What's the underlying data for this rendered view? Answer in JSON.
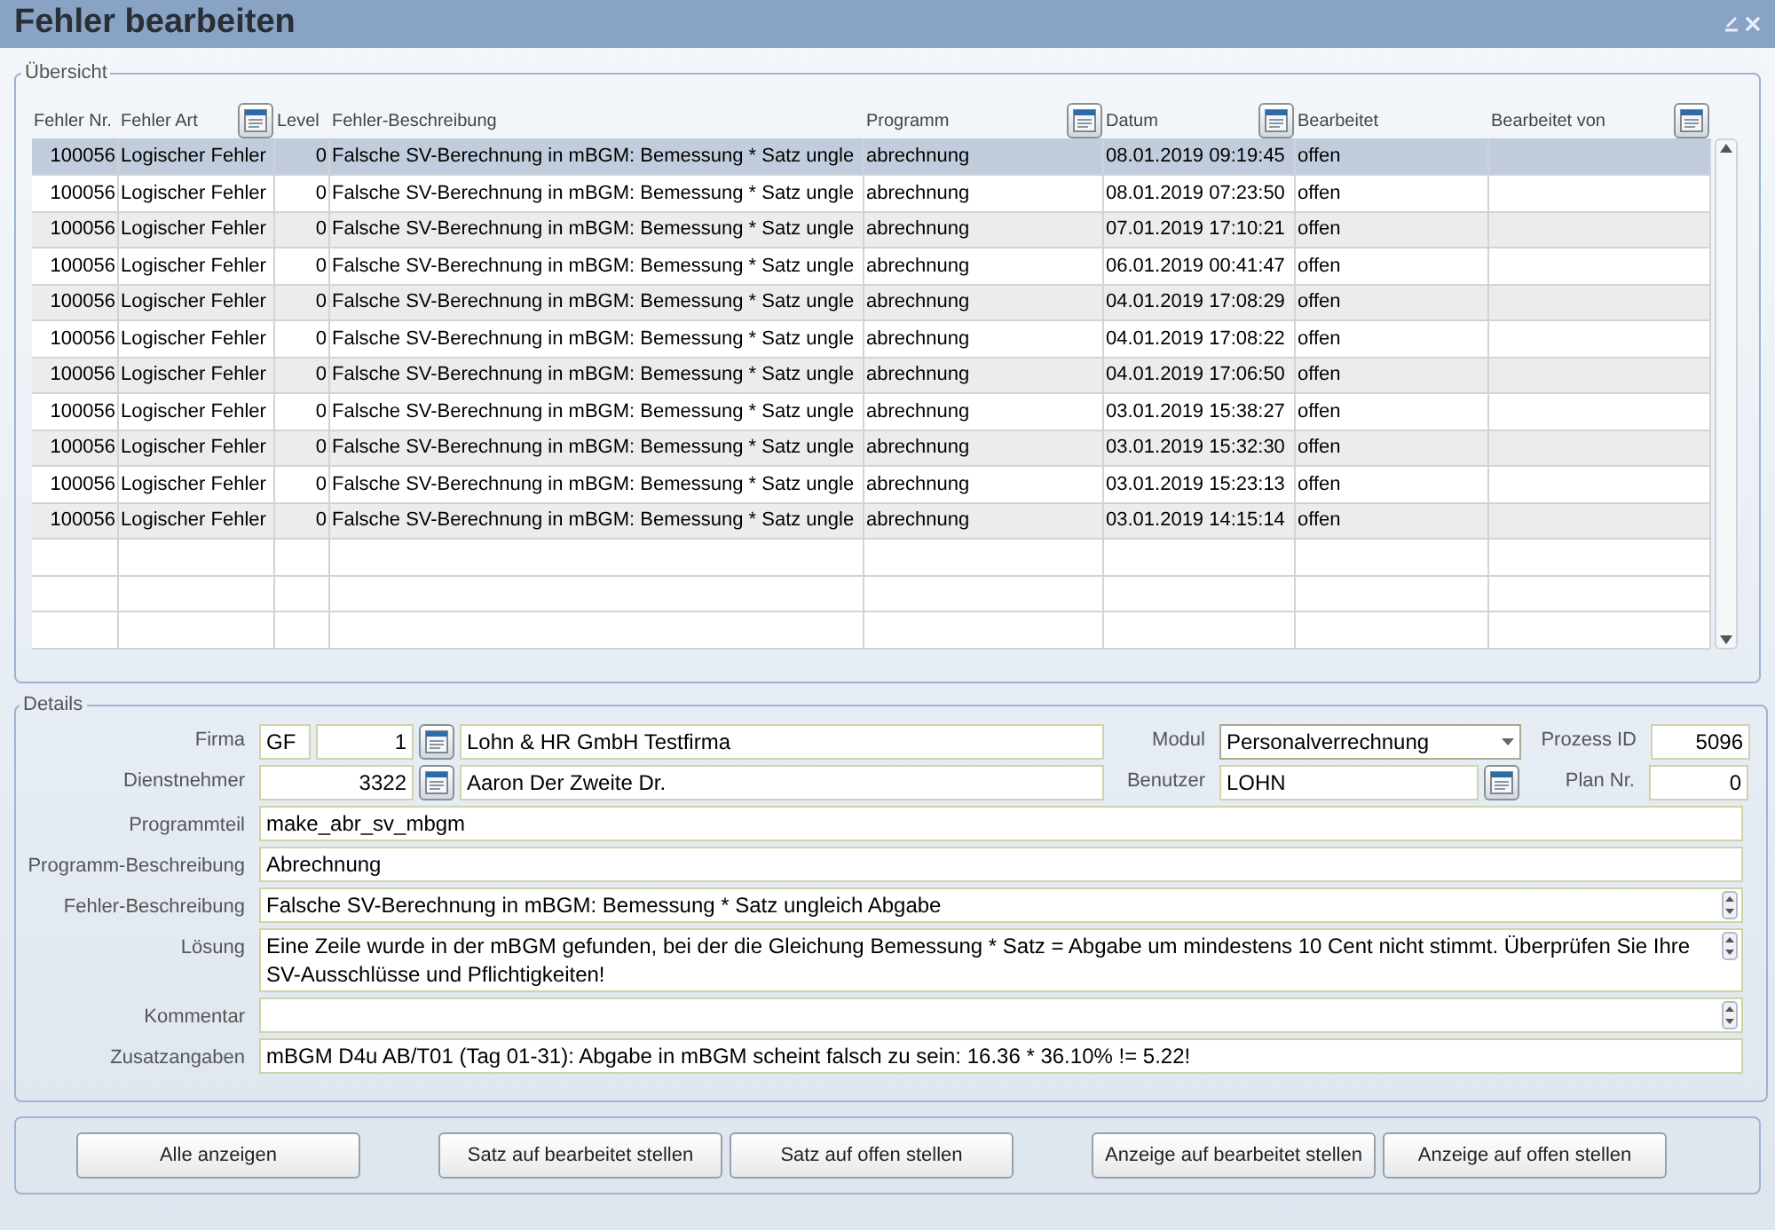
{
  "title": "Fehler bearbeiten",
  "overview": {
    "legend": "Übersicht",
    "columns": [
      {
        "label": "Fehler Nr.",
        "picker": false
      },
      {
        "label": "Fehler Art",
        "picker": true
      },
      {
        "label": "Level",
        "picker": false
      },
      {
        "label": "Fehler-Beschreibung",
        "picker": false
      },
      {
        "label": "Programm",
        "picker": true
      },
      {
        "label": "Datum",
        "picker": true
      },
      {
        "label": "Bearbeitet",
        "picker": false
      },
      {
        "label": "Bearbeitet von",
        "picker": true
      }
    ],
    "rows": [
      {
        "selected": true,
        "cells": [
          "100056",
          "Logischer Fehler",
          "0",
          "Falsche SV-Berechnung in mBGM: Bemessung * Satz ungle",
          "abrechnung",
          "08.01.2019 09:19:45",
          "offen"
        ]
      },
      {
        "selected": false,
        "cells": [
          "100056",
          "Logischer Fehler",
          "0",
          "Falsche SV-Berechnung in mBGM: Bemessung * Satz ungle",
          "abrechnung",
          "08.01.2019 07:23:50",
          "offen"
        ]
      },
      {
        "selected": false,
        "cells": [
          "100056",
          "Logischer Fehler",
          "0",
          "Falsche SV-Berechnung in mBGM: Bemessung * Satz ungle",
          "abrechnung",
          "07.01.2019 17:10:21",
          "offen"
        ]
      },
      {
        "selected": false,
        "cells": [
          "100056",
          "Logischer Fehler",
          "0",
          "Falsche SV-Berechnung in mBGM: Bemessung * Satz ungle",
          "abrechnung",
          "06.01.2019 00:41:47",
          "offen"
        ]
      },
      {
        "selected": false,
        "cells": [
          "100056",
          "Logischer Fehler",
          "0",
          "Falsche SV-Berechnung in mBGM: Bemessung * Satz ungle",
          "abrechnung",
          "04.01.2019 17:08:29",
          "offen"
        ]
      },
      {
        "selected": false,
        "cells": [
          "100056",
          "Logischer Fehler",
          "0",
          "Falsche SV-Berechnung in mBGM: Bemessung * Satz ungle",
          "abrechnung",
          "04.01.2019 17:08:22",
          "offen"
        ]
      },
      {
        "selected": false,
        "cells": [
          "100056",
          "Logischer Fehler",
          "0",
          "Falsche SV-Berechnung in mBGM: Bemessung * Satz ungle",
          "abrechnung",
          "04.01.2019 17:06:50",
          "offen"
        ]
      },
      {
        "selected": false,
        "cells": [
          "100056",
          "Logischer Fehler",
          "0",
          "Falsche SV-Berechnung in mBGM: Bemessung * Satz ungle",
          "abrechnung",
          "03.01.2019 15:38:27",
          "offen"
        ]
      },
      {
        "selected": false,
        "cells": [
          "100056",
          "Logischer Fehler",
          "0",
          "Falsche SV-Berechnung in mBGM: Bemessung * Satz ungle",
          "abrechnung",
          "03.01.2019 15:32:30",
          "offen"
        ]
      },
      {
        "selected": false,
        "cells": [
          "100056",
          "Logischer Fehler",
          "0",
          "Falsche SV-Berechnung in mBGM: Bemessung * Satz ungle",
          "abrechnung",
          "03.01.2019 15:23:13",
          "offen"
        ]
      },
      {
        "selected": false,
        "cells": [
          "100056",
          "Logischer Fehler",
          "0",
          "Falsche SV-Berechnung in mBGM: Bemessung * Satz ungle",
          "abrechnung",
          "03.01.2019 14:15:14",
          "offen"
        ]
      }
    ]
  },
  "details": {
    "legend": "Details",
    "firma": {
      "label": "Firma",
      "code": "GF",
      "number": "1",
      "name": "Lohn & HR GmbH Testfirma"
    },
    "modul": {
      "label": "Modul",
      "value": "Personalverrechnung"
    },
    "prozess_id": {
      "label": "Prozess ID",
      "value": "5096"
    },
    "dienstnehmer": {
      "label": "Dienstnehmer",
      "number": "3322",
      "name": "Aaron Der Zweite Dr."
    },
    "benutzer": {
      "label": "Benutzer",
      "value": "LOHN"
    },
    "plan_nr": {
      "label": "Plan Nr.",
      "value": "0"
    },
    "rows": [
      {
        "kind": "text",
        "label": "Programmteil",
        "value": "make_abr_sv_mbgm"
      },
      {
        "kind": "text",
        "label": "Programm-Beschreibung",
        "value": "Abrechnung"
      },
      {
        "kind": "scroll",
        "label": "Fehler-Beschreibung",
        "value": "Falsche SV-Berechnung in mBGM: Bemessung * Satz ungleich Abgabe"
      },
      {
        "kind": "scroll",
        "label": "Lösung",
        "value": "Eine Zeile wurde in der mBGM gefunden, bei der die Gleichung Bemessung * Satz = Abgabe um mindestens 10 Cent nicht stimmt. Überprüfen Sie Ihre SV-Ausschlüsse und Pflichtigkeiten!"
      },
      {
        "kind": "scroll",
        "label": "Kommentar"
      },
      {
        "kind": "text",
        "label": "Zusatzangaben",
        "value": "mBGM D4u AB/T01 (Tag 01-31): Abgabe in mBGM scheint falsch zu sein: 16.36 * 36.10% != 5.22!"
      }
    ]
  },
  "button_groups": [
    [
      "Alle anzeigen"
    ],
    [
      "Satz auf bearbeitet stellen",
      "Satz auf offen stellen"
    ],
    [
      "Anzeige auf bearbeitet stellen",
      "Anzeige auf offen stellen"
    ]
  ]
}
